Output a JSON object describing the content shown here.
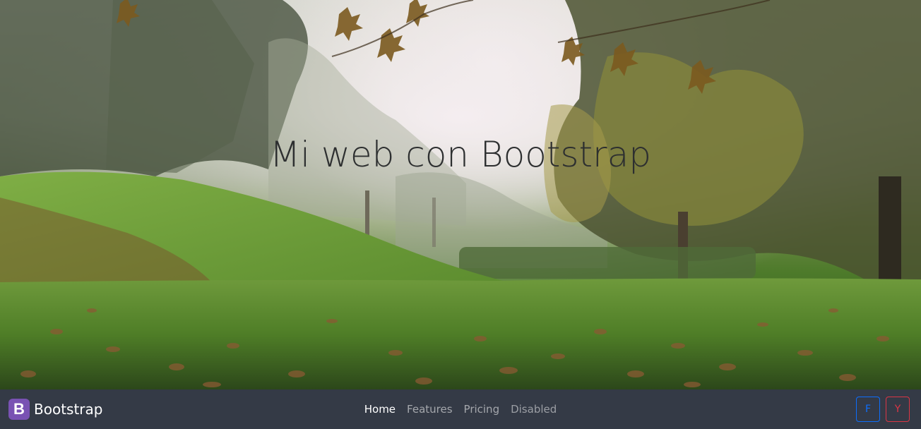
{
  "hero": {
    "title": "Mi web con Bootstrap"
  },
  "navbar": {
    "brand": {
      "logo_letter": "B",
      "name": "Bootstrap",
      "logo_color": "#7952b3"
    },
    "links": [
      {
        "label": "Home",
        "state": "active"
      },
      {
        "label": "Features",
        "state": "normal"
      },
      {
        "label": "Pricing",
        "state": "normal"
      },
      {
        "label": "Disabled",
        "state": "disabled"
      }
    ],
    "social": {
      "facebook_label": "F",
      "youtube_label": "Y",
      "facebook_color": "#0d6efd",
      "youtube_color": "#dc3545"
    },
    "background_color": "#343a46"
  }
}
